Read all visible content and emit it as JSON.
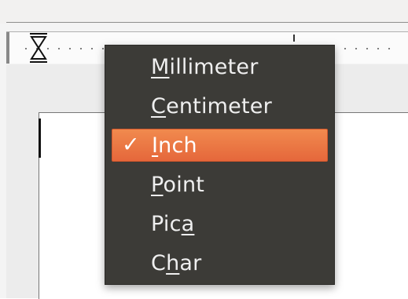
{
  "menu": {
    "items": [
      {
        "id": "millimeter",
        "label": "Millimeter",
        "before": "",
        "mnemonic": "M",
        "after": "illimeter",
        "selected": false
      },
      {
        "id": "centimeter",
        "label": "Centimeter",
        "before": "",
        "mnemonic": "C",
        "after": "entimeter",
        "selected": false
      },
      {
        "id": "inch",
        "label": "Inch",
        "before": "",
        "mnemonic": "I",
        "after": "nch",
        "selected": true
      },
      {
        "id": "point",
        "label": "Point",
        "before": "",
        "mnemonic": "P",
        "after": "oint",
        "selected": false
      },
      {
        "id": "pica",
        "label": "Pica",
        "before": "Pic",
        "mnemonic": "a",
        "after": "",
        "selected": false
      },
      {
        "id": "char",
        "label": "Char",
        "before": "C",
        "mnemonic": "h",
        "after": "ar",
        "selected": false
      }
    ],
    "check_glyph": "✓",
    "colors": {
      "background": "#3c3b37",
      "text": "#efefef",
      "selected_background": "#e96e3f",
      "selected_text": "#ffffff"
    }
  },
  "ruler": {
    "marker_icon": "hourglass-indent-marker-icon"
  }
}
